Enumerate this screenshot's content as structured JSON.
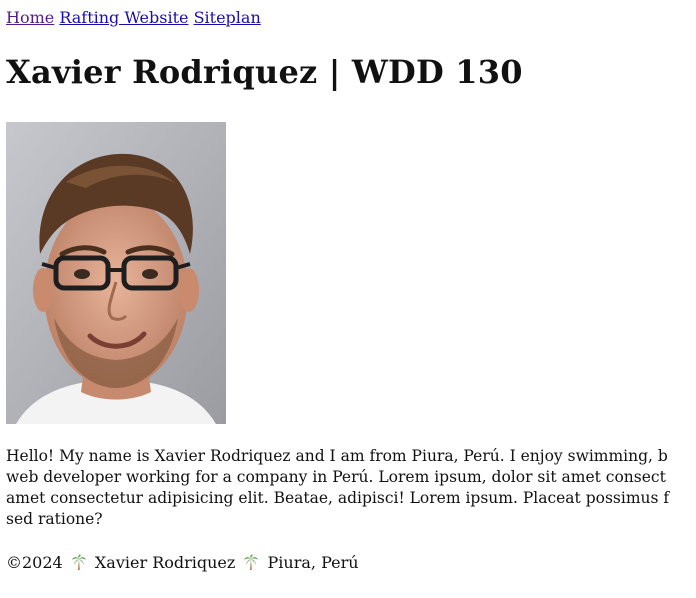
{
  "nav": {
    "links": [
      {
        "label": "Home"
      },
      {
        "label": "Rafting Website"
      },
      {
        "label": "Siteplan"
      }
    ]
  },
  "header": {
    "title": "Xavier Rodriquez | WDD 130"
  },
  "bio": {
    "lines": [
      "Hello! My name is Xavier Rodriquez and I am from Piura, Perú. I enjoy swimming, b",
      "web developer working for a company in Perú. Lorem ipsum, dolor sit amet consect",
      "amet consectetur adipisicing elit. Beatae, adipisci! Lorem ipsum. Placeat possimus f",
      "sed ratione?"
    ]
  },
  "footer": {
    "copyright": "©2024",
    "name": "Xavier Rodriquez",
    "location": "Piura, Perú"
  }
}
